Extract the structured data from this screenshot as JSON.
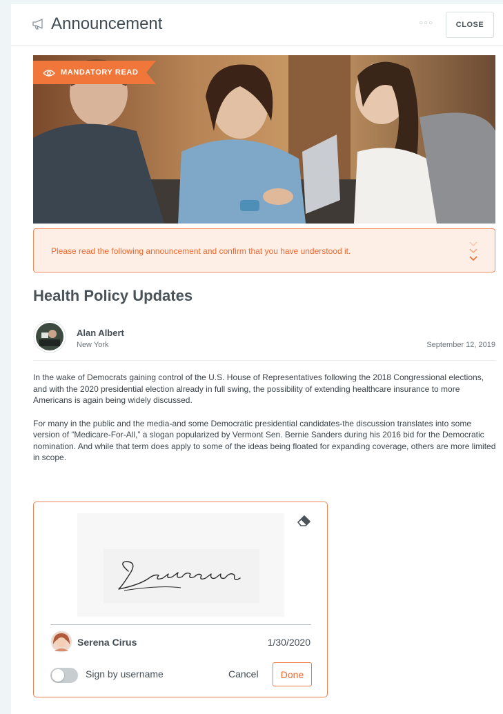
{
  "header": {
    "title": "Announcement",
    "menu_icon": "more-dots-icon",
    "close_label": "CLOSE"
  },
  "hero": {
    "badge_label": "MANDATORY READ",
    "badge_icon": "eye-icon"
  },
  "notice": {
    "text": "Please read the following announcement and confirm that you have understood it.",
    "icon": "chevrons-down-icon"
  },
  "post": {
    "title": "Health Policy Updates",
    "author_name": "Alan Albert",
    "author_location": "New York",
    "date": "September 12, 2019",
    "paragraphs": [
      "In the wake of Democrats gaining control of the U.S. House of Representatives following the 2018 Congressional elections, and with the 2020 presidential election already in full swing, the possibility of extending healthcare insurance to more Americans is again being widely discussed.",
      "For many in the public and the media-and some Democratic presidential candidates-the discussion translates into some version of “Medicare-For-All,” a slogan popularized by Vermont Sen. Bernie Sanders during his 2016 bid for the Democratic nomination. And while that term does apply to some of the ideas being floated for expanding coverage, others are more limited in scope."
    ]
  },
  "signature": {
    "signature_text": "Serenacirus",
    "signer_name": "Serena Cirus",
    "sign_date": "1/30/2020",
    "toggle_label": "Sign by username",
    "toggle_on": false,
    "cancel_label": "Cancel",
    "done_label": "Done",
    "eraser_icon": "eraser-icon"
  },
  "colors": {
    "accent": "#ee6a2f",
    "notice_bg": "#fdeee6",
    "title_text": "#3f4a52"
  }
}
